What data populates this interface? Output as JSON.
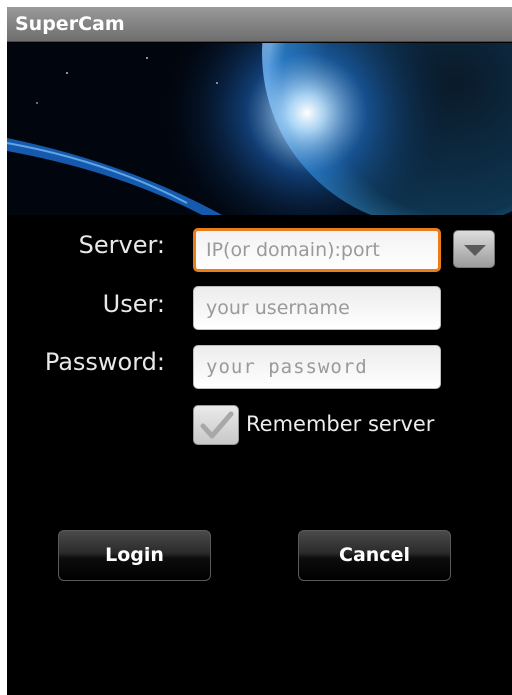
{
  "app": {
    "title": "SuperCam"
  },
  "form": {
    "server_label": "Server:",
    "server_placeholder": "IP(or domain):port",
    "user_label": "User:",
    "user_placeholder": "your   username",
    "password_label": "Password:",
    "password_placeholder": "your password",
    "remember_label": "Remember server",
    "remember_checked": true
  },
  "buttons": {
    "login_label": "Login",
    "cancel_label": "Cancel"
  },
  "colors": {
    "focus_accent": "#e97d1a",
    "background": "#000000"
  },
  "icons": {
    "dropdown": "chevron-down-icon",
    "checkbox": "checkmark-icon"
  }
}
